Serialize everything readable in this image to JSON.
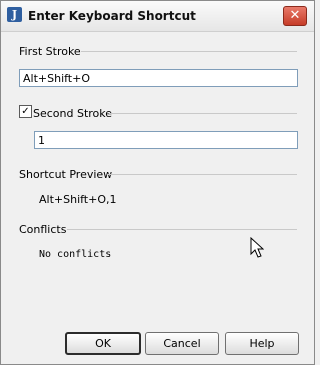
{
  "window": {
    "title": "Enter Keyboard Shortcut",
    "app_icon_glyph": "J",
    "close_glyph": "✕"
  },
  "first_stroke": {
    "label": "First Stroke",
    "value": "Alt+Shift+O"
  },
  "second_stroke": {
    "label": "Second Stroke",
    "checked": true,
    "check_glyph": "✓",
    "value": "1"
  },
  "shortcut_preview": {
    "label": "Shortcut Preview",
    "value": "Alt+Shift+O,1"
  },
  "conflicts": {
    "label": "Conflicts",
    "value": "No conflicts"
  },
  "buttons": {
    "ok": "OK",
    "cancel": "Cancel",
    "help": "Help"
  },
  "colors": {
    "close_button": "#c63c28",
    "field_border": "#7f9db9"
  }
}
